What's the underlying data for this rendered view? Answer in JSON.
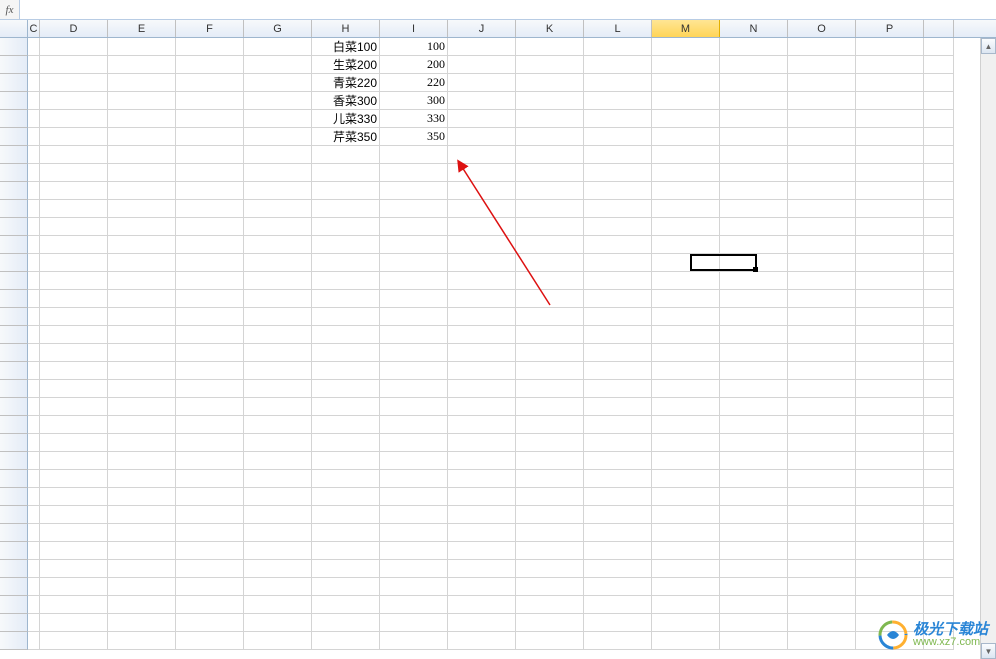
{
  "formula_bar": {
    "fx_label": "fx",
    "value": ""
  },
  "columns": [
    "C",
    "D",
    "E",
    "F",
    "G",
    "H",
    "I",
    "J",
    "K",
    "L",
    "M",
    "N",
    "O",
    "P"
  ],
  "selected_column": "M",
  "selected_cell": {
    "col": "M",
    "row": 13
  },
  "cells": {
    "H1": "白菜100",
    "I1": "100",
    "H2": "生菜200",
    "I2": "200",
    "H3": "青菜220",
    "I3": "220",
    "H4": "香菜300",
    "I4": "300",
    "H5": "儿菜330",
    "I5": "330",
    "H6": "芹菜350",
    "I6": "350"
  },
  "watermark": {
    "title": "极光下载站",
    "url": "www.xz7.com"
  },
  "scrollbar": {
    "up": "▲",
    "down": "▼"
  }
}
